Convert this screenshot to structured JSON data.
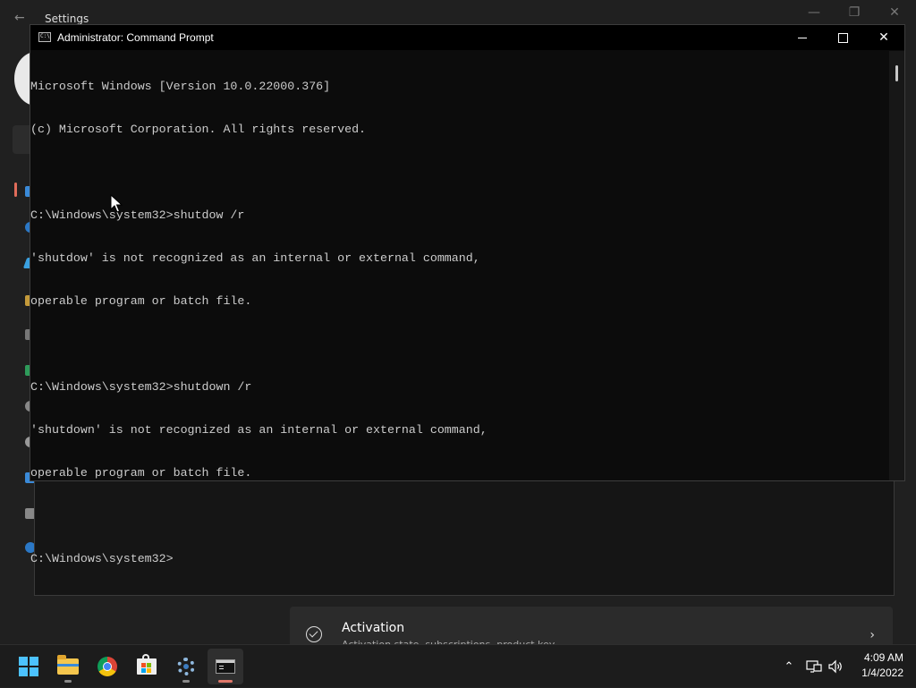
{
  "settings": {
    "title": "Settings",
    "back_icon": "back-arrow-icon",
    "activation": {
      "title": "Activation",
      "subtitle": "Activation state, subscriptions, product key"
    }
  },
  "cmd": {
    "title": "Administrator: Command Prompt",
    "lines": [
      "Microsoft Windows [Version 10.0.22000.376]",
      "(c) Microsoft Corporation. All rights reserved.",
      "",
      "C:\\Windows\\system32>shutdow /r",
      "'shutdow' is not recognized as an internal or external command,",
      "operable program or batch file.",
      "",
      "C:\\Windows\\system32>shutdown /r",
      "'shutdown' is not recognized as an internal or external command,",
      "operable program or batch file.",
      "",
      "C:\\Windows\\system32>"
    ]
  },
  "taskbar": {
    "apps": [
      {
        "name": "start",
        "icon": "windows-logo-icon"
      },
      {
        "name": "file-explorer",
        "icon": "folder-icon"
      },
      {
        "name": "chrome",
        "icon": "chrome-icon"
      },
      {
        "name": "microsoft-store",
        "icon": "store-icon"
      },
      {
        "name": "settings",
        "icon": "gear-icon"
      },
      {
        "name": "command-prompt",
        "icon": "terminal-icon"
      }
    ],
    "time": "4:09 AM",
    "date": "1/4/2022"
  },
  "colors": {
    "accent": "#4cc2ff",
    "console_text": "#cccccc",
    "console_bg": "#0c0c0c",
    "active_indicator": "#e0786a"
  }
}
